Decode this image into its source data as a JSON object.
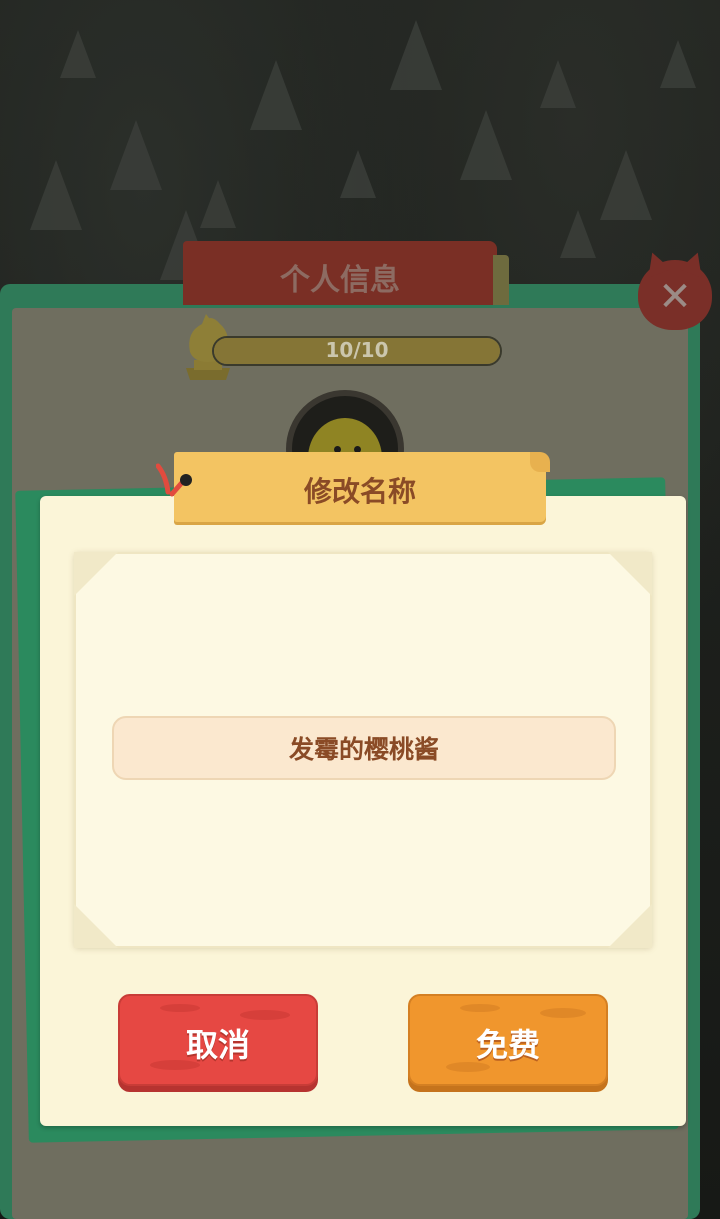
{
  "profile": {
    "title": "个人信息",
    "level_text": "10/10",
    "level_fraction": 1.0,
    "close_label": "✕"
  },
  "rename_dialog": {
    "title": "修改名称",
    "input_value": "发霉的樱桃酱",
    "cancel_label": "取消",
    "confirm_label": "免费"
  },
  "colors": {
    "cancel": "#e64843",
    "confirm": "#f0962d",
    "tab": "#f3c462",
    "panel": "#fbf5d8",
    "text_brown": "#8a4b26"
  },
  "icons": [
    "trophy-icon",
    "close-icon",
    "avatar-chick-icon",
    "pin-icon"
  ]
}
